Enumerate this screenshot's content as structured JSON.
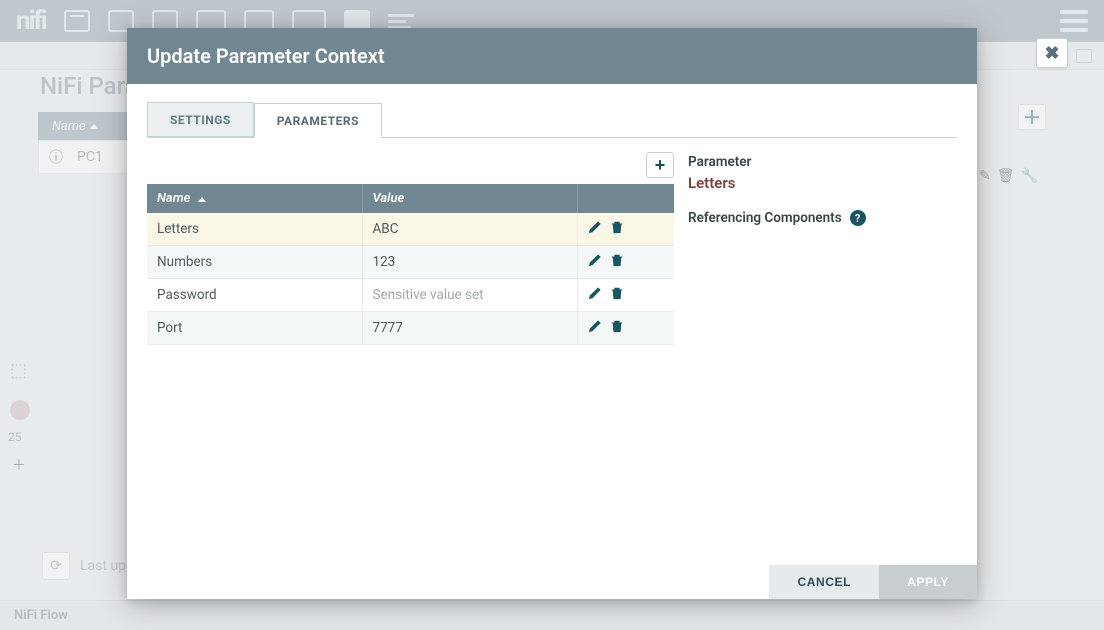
{
  "background": {
    "panel_title": "NiFi Parameter Contexts",
    "header_col": "Name",
    "row_item": "PC1",
    "last_upd": "Last updated",
    "footer": "NiFi Flow",
    "badge25": "25"
  },
  "close_x": "✖",
  "modal": {
    "title": "Update Parameter Context",
    "tabs": {
      "settings": "SETTINGS",
      "parameters": "PARAMETERS"
    },
    "add_plus": "+",
    "table": {
      "head_name": "Name",
      "head_value": "Value",
      "rows": [
        {
          "name": "Letters",
          "value": "ABC",
          "sensitive": false,
          "selected": true
        },
        {
          "name": "Numbers",
          "value": "123",
          "sensitive": false,
          "selected": false
        },
        {
          "name": "Password",
          "value": "Sensitive value set",
          "sensitive": true,
          "selected": false
        },
        {
          "name": "Port",
          "value": "7777",
          "sensitive": false,
          "selected": false
        }
      ]
    },
    "right": {
      "label": "Parameter",
      "name": "Letters",
      "ref": "Referencing Components"
    },
    "buttons": {
      "cancel": "CANCEL",
      "apply": "APPLY"
    }
  }
}
